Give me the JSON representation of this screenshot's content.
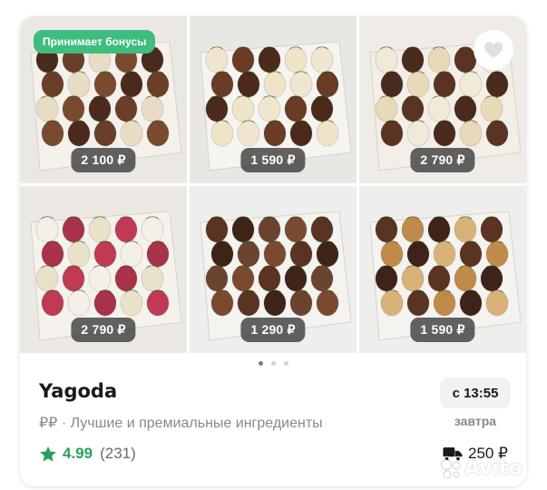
{
  "listing": {
    "bonus_badge": "Принимает бонусы",
    "favorite_icon": "heart-icon",
    "photos": [
      {
        "price": "2 100 ₽",
        "bg": "#ebe8e4",
        "box": "#f4f1ec"
      },
      {
        "price": "1 590 ₽",
        "bg": "#e9e7e3",
        "box": "#f6f4f0"
      },
      {
        "price": "2 790 ₽",
        "bg": "#efece7",
        "box": "#f3efe8"
      },
      {
        "price": "2 790 ₽",
        "bg": "#ece9e5",
        "box": "#f5f2ee"
      },
      {
        "price": "1 290 ₽",
        "bg": "#eeeeec",
        "box": "#f4f3f0"
      },
      {
        "price": "1 590 ₽",
        "bg": "#efeeec",
        "box": "#f5f3ef"
      }
    ],
    "pagination": {
      "total": 3,
      "active": 0
    },
    "store_name": "Yagoda",
    "price_level": "₽₽",
    "description": "Лучшие и премиальные ингредиенты",
    "rating": "4.99",
    "reviews_count": "(231)",
    "delivery_time": "с 13:55",
    "delivery_day": "завтра",
    "delivery_price": "250 ₽",
    "delivery_icon": "truck-icon",
    "rating_icon": "star-icon",
    "watermark": "Avito"
  },
  "colors": {
    "accent_green": "#3dbd7e",
    "rating_green": "#2b9e5b"
  }
}
